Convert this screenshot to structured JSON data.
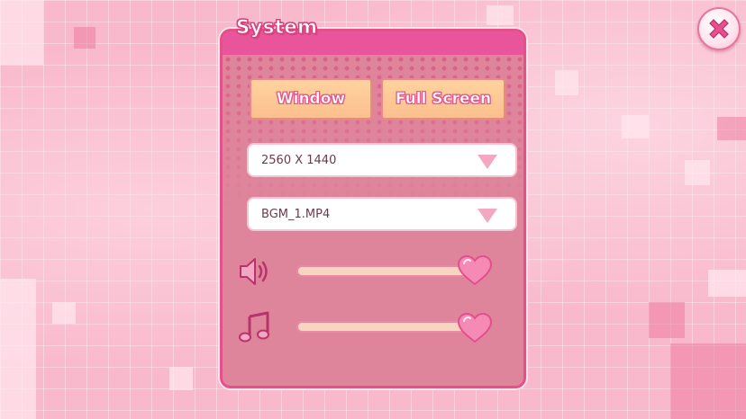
{
  "panel": {
    "title": "System"
  },
  "display_mode": {
    "window_label": "Window",
    "fullscreen_label": "Full Screen"
  },
  "resolution": {
    "selected": "2560 X 1440"
  },
  "bgm": {
    "selected": "BGM_1.MP4"
  },
  "volume": {
    "level": 1.0,
    "icon": "speaker-icon"
  },
  "music": {
    "level": 1.0,
    "icon": "music-note-icon"
  },
  "close": {
    "icon": "close-icon"
  },
  "colors": {
    "accent": "#e8559a",
    "panel": "#df859b",
    "button": "#fbbf8e",
    "background": "#f9b9cc"
  }
}
